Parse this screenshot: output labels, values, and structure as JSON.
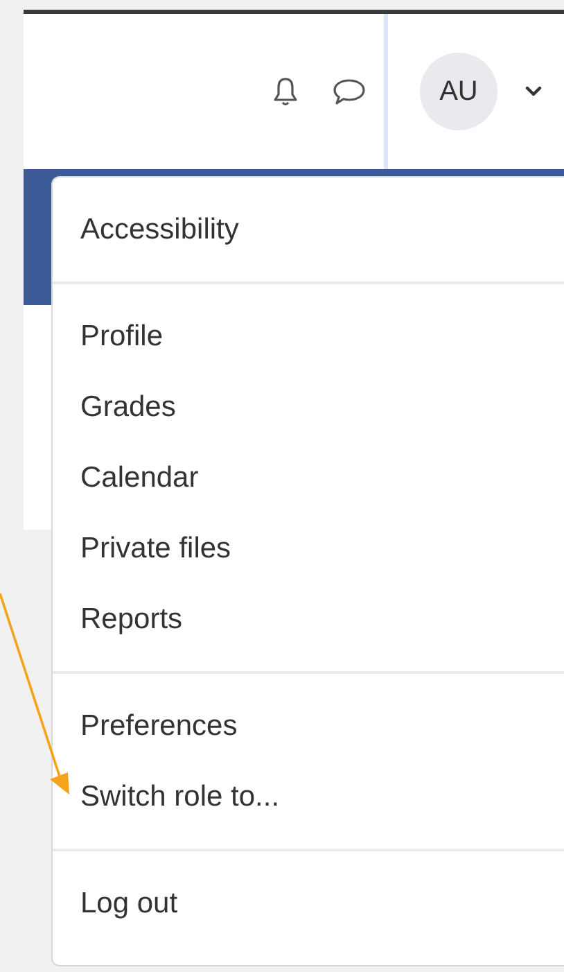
{
  "header": {
    "avatar": {
      "initials": "AU"
    }
  },
  "user_menu": {
    "sections": [
      {
        "items": [
          {
            "label": "Accessibility"
          }
        ]
      },
      {
        "items": [
          {
            "label": "Profile"
          },
          {
            "label": "Grades"
          },
          {
            "label": "Calendar"
          },
          {
            "label": "Private files"
          },
          {
            "label": "Reports"
          }
        ]
      },
      {
        "items": [
          {
            "label": "Preferences"
          },
          {
            "label": "Switch role to..."
          }
        ]
      },
      {
        "items": [
          {
            "label": "Log out"
          }
        ]
      }
    ]
  }
}
